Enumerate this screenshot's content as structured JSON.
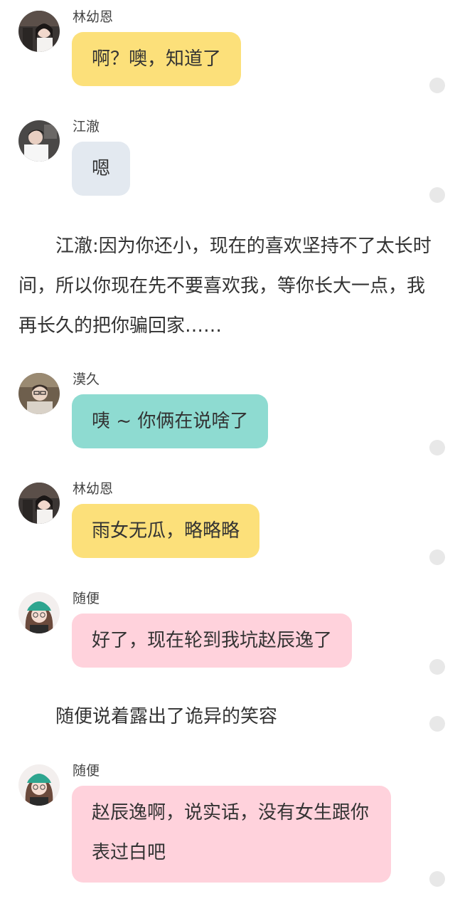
{
  "colors": {
    "yellow": "#fce07a",
    "gray": "#e3e9f0",
    "teal": "#8edbd1",
    "pink": "#ffd2dc",
    "dot": "#e8e8e8"
  },
  "messages": [
    {
      "sender": "林幼恩",
      "text": "啊？噢，知道了",
      "avatar": "girl-dark-hair-avatar"
    },
    {
      "sender": "江澈",
      "text": "嗯",
      "avatar": "boy-white-shirt-avatar"
    },
    {
      "sender": "漠久",
      "text": "咦 ~ 你俩在说啥了",
      "avatar": "boy-glasses-avatar"
    },
    {
      "sender": "林幼恩",
      "text": "雨女无瓜，略略略",
      "avatar": "girl-dark-hair-avatar"
    },
    {
      "sender": "随便",
      "text": "好了，现在轮到我坑赵辰逸了",
      "avatar": "girl-green-cap-avatar"
    },
    {
      "sender": "随便",
      "text": "赵辰逸啊，说实话，没有女生跟你表过白吧",
      "avatar": "girl-green-cap-avatar"
    }
  ],
  "narration": {
    "first": "　　江澈:因为你还小，现在的喜欢坚持不了太长时间，所以你现在先不要喜欢我，等你长大一点，我再长久的把你骗回家……",
    "second": "　　随便说着露出了诡异的笑容"
  }
}
